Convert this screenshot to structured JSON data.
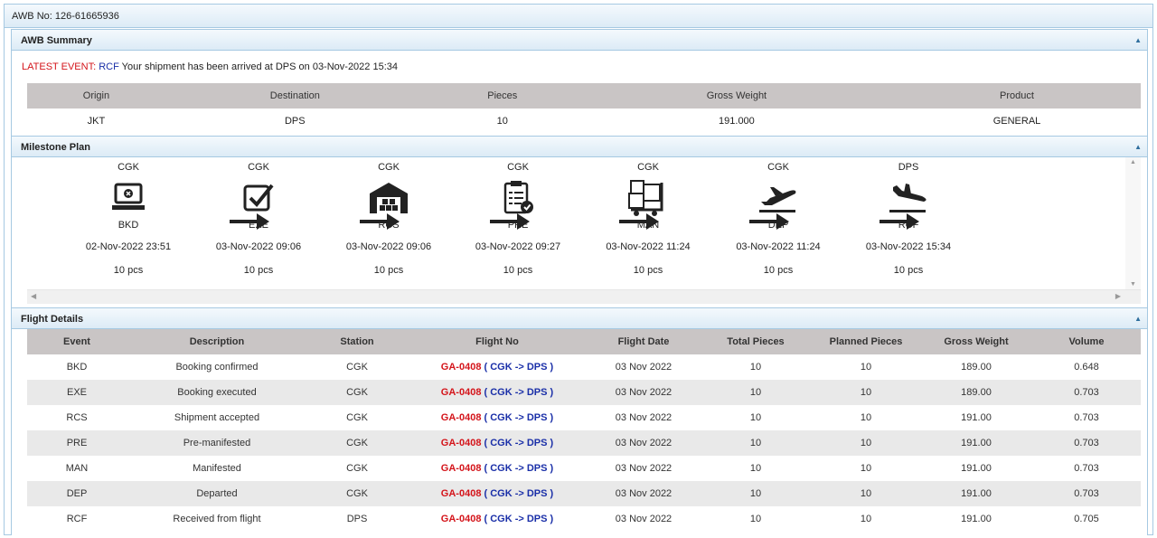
{
  "awb_header": "AWB No: 126-61665936",
  "summary": {
    "title": "AWB Summary",
    "latest_label": "LATEST EVENT:",
    "latest_code": "RCF",
    "latest_text": "Your shipment has been arrived at DPS on 03-Nov-2022 15:34",
    "headers": [
      "Origin",
      "Destination",
      "Pieces",
      "Gross Weight",
      "Product"
    ],
    "values": [
      "JKT",
      "DPS",
      "10",
      "191.000",
      "GENERAL"
    ]
  },
  "milestone": {
    "title": "Milestone Plan",
    "steps": [
      {
        "station": "CGK",
        "code": "BKD",
        "time": "02-Nov-2022 23:51",
        "pcs": "10 pcs",
        "icon": "laptop-icon"
      },
      {
        "station": "CGK",
        "code": "EXE",
        "time": "03-Nov-2022 09:06",
        "pcs": "10 pcs",
        "icon": "checkbox-icon"
      },
      {
        "station": "CGK",
        "code": "RCS",
        "time": "03-Nov-2022 09:06",
        "pcs": "10 pcs",
        "icon": "warehouse-icon"
      },
      {
        "station": "CGK",
        "code": "PRE",
        "time": "03-Nov-2022 09:27",
        "pcs": "10 pcs",
        "icon": "clipboard-icon"
      },
      {
        "station": "CGK",
        "code": "MAN",
        "time": "03-Nov-2022 11:24",
        "pcs": "10 pcs",
        "icon": "cargo-cart-icon"
      },
      {
        "station": "CGK",
        "code": "DEP",
        "time": "03-Nov-2022 11:24",
        "pcs": "10 pcs",
        "icon": "plane-departure-icon"
      },
      {
        "station": "DPS",
        "code": "RCF",
        "time": "03-Nov-2022 15:34",
        "pcs": "10 pcs",
        "icon": "plane-arrival-icon"
      }
    ]
  },
  "flights": {
    "title": "Flight Details",
    "headers": [
      "Event",
      "Description",
      "Station",
      "Flight No",
      "Flight Date",
      "Total Pieces",
      "Planned Pieces",
      "Gross Weight",
      "Volume"
    ],
    "rows": [
      {
        "event": "BKD",
        "desc": "Booking confirmed",
        "station": "CGK",
        "fno": "GA-0408",
        "route": "( CGK -> DPS )",
        "date": "03 Nov 2022",
        "total": "10",
        "planned": "10",
        "weight": "189.00",
        "volume": "0.648"
      },
      {
        "event": "EXE",
        "desc": "Booking executed",
        "station": "CGK",
        "fno": "GA-0408",
        "route": "( CGK -> DPS )",
        "date": "03 Nov 2022",
        "total": "10",
        "planned": "10",
        "weight": "189.00",
        "volume": "0.703"
      },
      {
        "event": "RCS",
        "desc": "Shipment accepted",
        "station": "CGK",
        "fno": "GA-0408",
        "route": "( CGK -> DPS )",
        "date": "03 Nov 2022",
        "total": "10",
        "planned": "10",
        "weight": "191.00",
        "volume": "0.703"
      },
      {
        "event": "PRE",
        "desc": "Pre-manifested",
        "station": "CGK",
        "fno": "GA-0408",
        "route": "( CGK -> DPS )",
        "date": "03 Nov 2022",
        "total": "10",
        "planned": "10",
        "weight": "191.00",
        "volume": "0.703"
      },
      {
        "event": "MAN",
        "desc": "Manifested",
        "station": "CGK",
        "fno": "GA-0408",
        "route": "( CGK -> DPS )",
        "date": "03 Nov 2022",
        "total": "10",
        "planned": "10",
        "weight": "191.00",
        "volume": "0.703"
      },
      {
        "event": "DEP",
        "desc": "Departed",
        "station": "CGK",
        "fno": "GA-0408",
        "route": "( CGK -> DPS )",
        "date": "03 Nov 2022",
        "total": "10",
        "planned": "10",
        "weight": "191.00",
        "volume": "0.703"
      },
      {
        "event": "RCF",
        "desc": "Received from flight",
        "station": "DPS",
        "fno": "GA-0408",
        "route": "( CGK -> DPS )",
        "date": "03 Nov 2022",
        "total": "10",
        "planned": "10",
        "weight": "191.00",
        "volume": "0.705"
      }
    ]
  },
  "colors": {
    "accent_red": "#d4141a",
    "accent_blue": "#1a2fa8",
    "header_gray": "#c9c5c5",
    "border_blue": "#a6c9e2"
  }
}
